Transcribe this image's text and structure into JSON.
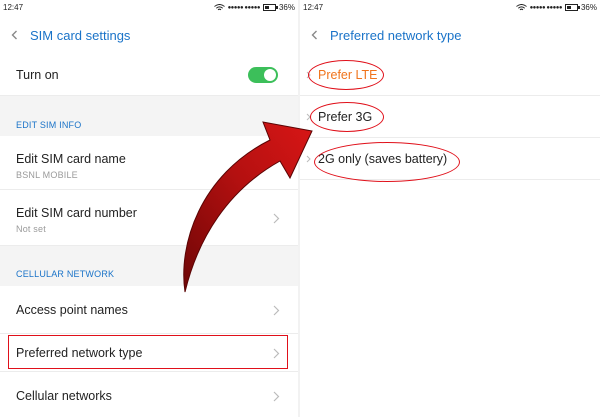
{
  "left": {
    "status": {
      "time": "12:47",
      "signal": "●●●●● ●●●●●",
      "battery": "36%"
    },
    "header": {
      "title": "SIM card settings"
    },
    "turn_on": {
      "label": "Turn on",
      "enabled": true
    },
    "section_edit": "EDIT SIM INFO",
    "edit_name": {
      "label": "Edit SIM card name",
      "value": "BSNL MOBILE"
    },
    "edit_number": {
      "label": "Edit SIM card number",
      "value": "Not set"
    },
    "section_cellular": "CELLULAR NETWORK",
    "access_point": {
      "label": "Access point names"
    },
    "preferred_network": {
      "label": "Preferred network type"
    },
    "cellular_networks": {
      "label": "Cellular networks"
    }
  },
  "right": {
    "status": {
      "time": "12:47",
      "signal": "●●●●● ●●●●●",
      "battery": "36%"
    },
    "header": {
      "title": "Preferred network type"
    },
    "options": [
      {
        "label": "Prefer LTE",
        "selected": true
      },
      {
        "label": "Prefer 3G",
        "selected": false
      },
      {
        "label": "2G only (saves battery)",
        "selected": false
      }
    ]
  },
  "colors": {
    "accent": "#1a73c8",
    "selected": "#f0741c",
    "toggle_on": "#3cbf5a",
    "annotation": "#e0101a",
    "arrow": "#9e0a0a"
  },
  "icons": [
    "back-icon",
    "chevron-right-icon",
    "wifi-icon",
    "battery-icon"
  ]
}
